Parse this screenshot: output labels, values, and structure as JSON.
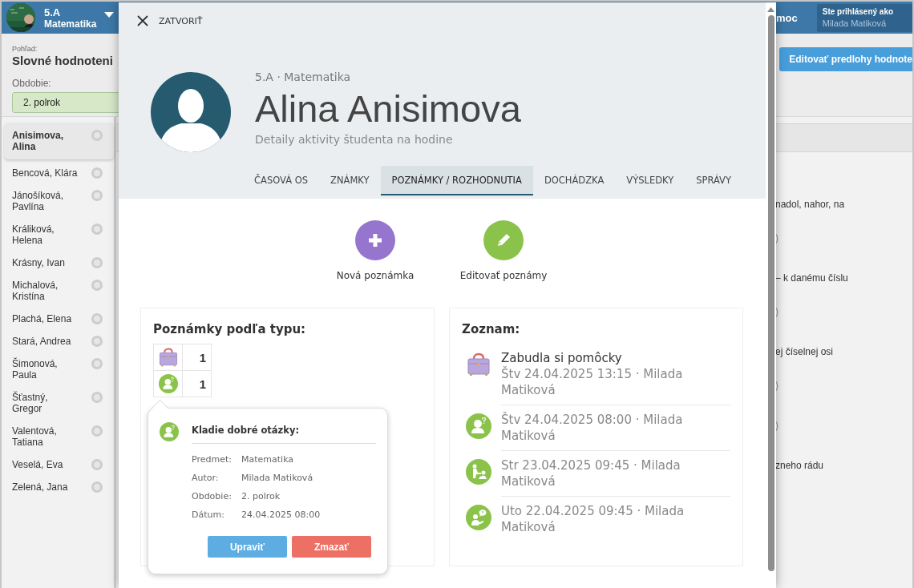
{
  "app_header": {
    "class_name": "5.A",
    "subject": "Matematika",
    "help": "moc",
    "login_label": "Ste prihlásený ako",
    "login_user": "Milada Matiková"
  },
  "toolbar": {
    "view_label": "Pohľad:",
    "view_value": "Slovné hodnoteni",
    "period_label": "Obdobie:",
    "period_value": "2. polrok",
    "edit_templates_button": "Editovať predlohy hodnote"
  },
  "students": [
    {
      "name": "Anisimova, Alina",
      "selected": true
    },
    {
      "name": "Bencová, Klára",
      "selected": false
    },
    {
      "name": "Jánošíková, Pavlína",
      "selected": false
    },
    {
      "name": "Králiková, Helena",
      "selected": false
    },
    {
      "name": "Krásny, Ivan",
      "selected": false
    },
    {
      "name": "Michalová, Kristína",
      "selected": false
    },
    {
      "name": "Plachá, Elena",
      "selected": false
    },
    {
      "name": "Stará, Andrea",
      "selected": false
    },
    {
      "name": "Šimonová, Paula",
      "selected": false
    },
    {
      "name": "Šťastný, Gregor",
      "selected": false
    },
    {
      "name": "Valentová, Tatiana",
      "selected": false
    },
    {
      "name": "Veselá, Eva",
      "selected": false
    },
    {
      "name": "Zelená, Jana",
      "selected": false
    }
  ],
  "background_groups": [
    {
      "text": "nadol, nahor, na",
      "note": ")"
    },
    {
      "text": "– k danému číslu",
      "note": ")"
    },
    {
      "text": "ej číselnej osi",
      "note": ")"
    },
    {
      "note": ")"
    },
    {
      "text": "zneho rádu"
    }
  ],
  "modal": {
    "close": "ZATVORIŤ",
    "context": "5.A · Matematika",
    "student_name": "Alina Anisimova",
    "subtitle": "Detaily aktivity študenta na hodine",
    "tabs": [
      {
        "label": "ČASOVÁ OS",
        "selected": false
      },
      {
        "label": "ZNÁMKY",
        "selected": false
      },
      {
        "label": "POZNÁMKY / ROZHODNUTIA",
        "selected": true
      },
      {
        "label": "DOCHÁDZKA",
        "selected": false
      },
      {
        "label": "VÝSLEDKY",
        "selected": false
      },
      {
        "label": "SPRÁVY",
        "selected": false
      }
    ],
    "actions": [
      {
        "kind": "add",
        "label": "Nová poznámka"
      },
      {
        "kind": "edit",
        "label": "Editovať poznámy"
      }
    ],
    "by_type": {
      "title": "Poznámky podľa typu:",
      "rows": [
        {
          "kind": "bag",
          "count": "1"
        },
        {
          "kind": "question",
          "count": "1"
        }
      ]
    },
    "list": {
      "title": "Zoznam:",
      "items": [
        {
          "kind": "bag",
          "title": "Zabudla si pomôcky",
          "meta": "Štv 24.04.2025 13:15 · Milada Matiková"
        },
        {
          "kind": "question",
          "meta": "Štv 24.04.2025 08:00 · Milada Matiková"
        },
        {
          "kind": "helping",
          "meta": "Str 23.04.2025 09:45 · Milada Matiková"
        },
        {
          "kind": "speech",
          "meta": "Uto 22.04.2025 09:45 · Milada Matiková"
        }
      ]
    },
    "popover": {
      "kind": "question",
      "title": "Kladie dobré otázky:",
      "fields": [
        {
          "label": "Predmet:",
          "value": "Matematika"
        },
        {
          "label": "Autor:",
          "value": "Milada Matiková"
        },
        {
          "label": "Obdobie:",
          "value": "2. polrok"
        },
        {
          "label": "Dátum:",
          "value": "24.04.2025 08:00"
        }
      ],
      "buttons": [
        {
          "kind": "edit",
          "label": "Upraviť"
        },
        {
          "kind": "delete",
          "label": "Zmazať"
        }
      ]
    }
  }
}
